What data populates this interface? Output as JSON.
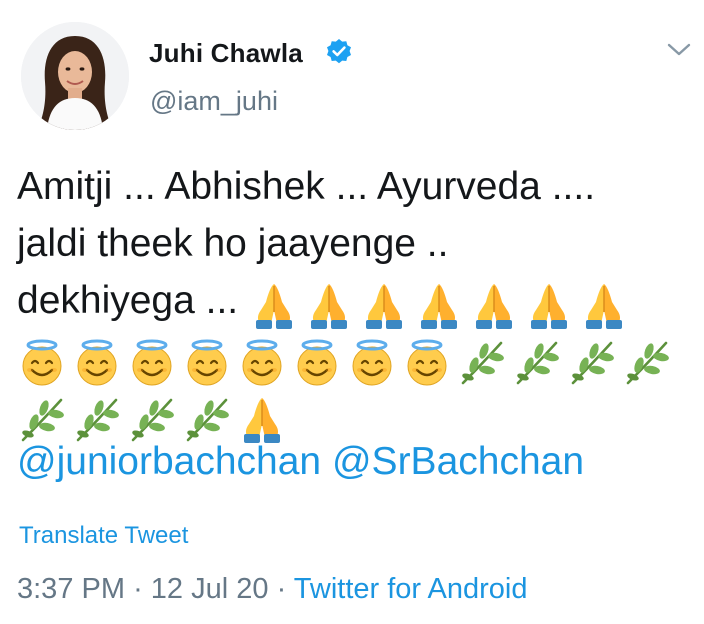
{
  "tweet": {
    "author": {
      "name": "Juhi Chawla",
      "handle": "@iam_juhi",
      "verified": true
    },
    "body": {
      "line1": "Amitji ... Abhishek ... Ayurveda ....",
      "line2": "jaldi theek ho jaayenge ..",
      "line3": "dekhiyega ..."
    },
    "emoji_sequence": [
      "folded-hands x7",
      "smiling-face-with-halo x8",
      "herb x4",
      "herb x4",
      "folded-hands x1"
    ],
    "mentions": [
      "@juniorbachchan",
      "@SrBachchan"
    ],
    "translate_label": "Translate Tweet",
    "meta": {
      "time": "3:37 PM",
      "separator": "·",
      "date": "12 Jul 20",
      "source": "Twitter for Android"
    },
    "colors": {
      "link": "#1b95e0",
      "secondary_text": "#657786",
      "primary_text": "#14171a"
    }
  }
}
